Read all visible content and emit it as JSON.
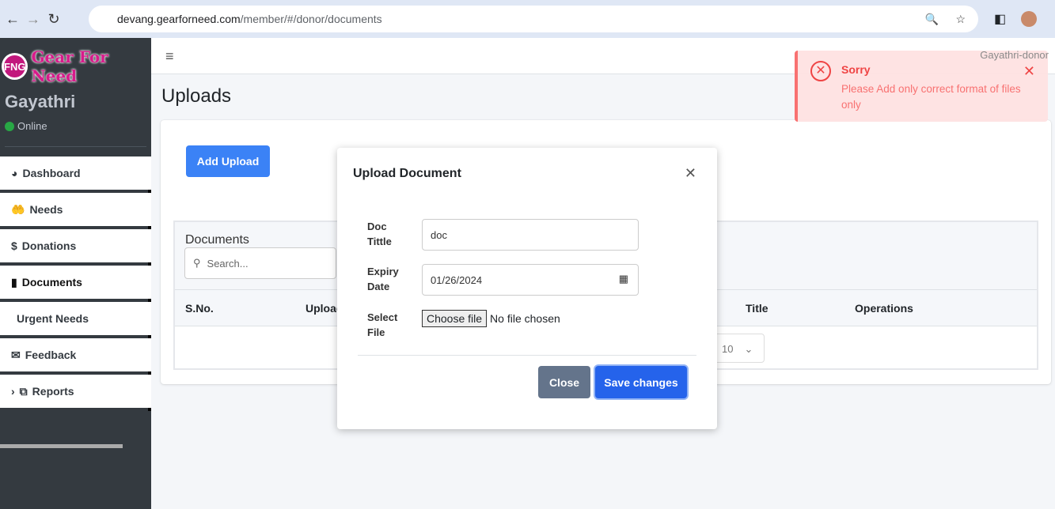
{
  "browser": {
    "url_host": "devang.gearforneed.com",
    "url_path": "/member/#/donor/documents"
  },
  "sidebar": {
    "logo_text": "Gear For Need",
    "logo_mark": "FNG",
    "user_name": "Gayathri",
    "status": "Online",
    "items": [
      {
        "label": "Dashboard",
        "icon": "pie-chart-icon"
      },
      {
        "label": "Needs",
        "icon": "hand-holding-icon"
      },
      {
        "label": "Donations",
        "icon": "donate-icon"
      },
      {
        "label": "Documents",
        "icon": "file-icon"
      },
      {
        "label": "Urgent Needs",
        "icon": ""
      },
      {
        "label": "Feedback",
        "icon": "envelope-icon"
      },
      {
        "label": "Reports",
        "icon": "copy-icon"
      }
    ]
  },
  "topbar": {
    "user": "Gayathri-donor"
  },
  "page": {
    "title": "Uploads",
    "add_upload": "Add Upload"
  },
  "documents": {
    "title": "Documents",
    "search_placeholder": "Search...",
    "columns": [
      "S.No.",
      "Upload",
      "Title",
      "Operations"
    ],
    "page_size": "10"
  },
  "modal": {
    "title": "Upload Document",
    "doc_title_label": "Doc Tittle",
    "doc_title_value": "doc",
    "expiry_label": "Expiry Date",
    "expiry_value": "01/26/2024",
    "file_label": "Select File",
    "choose_file": "Choose file",
    "no_file": "No file chosen",
    "close": "Close",
    "save": "Save changes"
  },
  "toast": {
    "title": "Sorry",
    "message": "Please Add only correct format of files only",
    "color": "#ef4444"
  }
}
